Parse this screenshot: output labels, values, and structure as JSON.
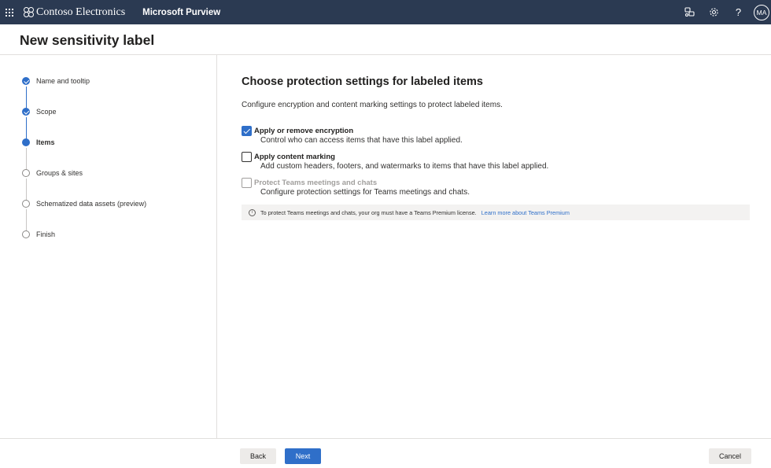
{
  "topbar": {
    "org_name": "Contoso Electronics",
    "app_name": "Microsoft Purview",
    "avatar_initials": "MA",
    "help_label": "?"
  },
  "page": {
    "title": "New sensitivity label"
  },
  "stepper": {
    "steps": [
      {
        "label": "Name and tooltip",
        "state": "completed"
      },
      {
        "label": "Scope",
        "state": "completed"
      },
      {
        "label": "Items",
        "state": "current"
      },
      {
        "label": "Groups & sites",
        "state": "pending"
      },
      {
        "label": "Schematized data assets (preview)",
        "state": "pending"
      },
      {
        "label": "Finish",
        "state": "pending"
      }
    ]
  },
  "main": {
    "heading": "Choose protection settings for labeled items",
    "description": "Configure encryption and content marking settings to protect labeled items.",
    "options": [
      {
        "title": "Apply or remove encryption",
        "description": "Control who can access items that have this label applied.",
        "checked": true,
        "disabled": false
      },
      {
        "title": "Apply content marking",
        "description": "Add custom headers, footers, and watermarks to items that have this label applied.",
        "checked": false,
        "disabled": false
      },
      {
        "title": "Protect Teams meetings and chats",
        "description": "Configure protection settings for Teams meetings and chats.",
        "checked": false,
        "disabled": true
      }
    ],
    "info": {
      "text": "To protect Teams meetings and chats, your org must have a Teams Premium license.",
      "link": "Learn more about Teams Premium"
    }
  },
  "footer": {
    "back_label": "Back",
    "next_label": "Next",
    "cancel_label": "Cancel"
  },
  "colors": {
    "topbar": "#2b3a52",
    "accent": "#2f6fc9"
  }
}
